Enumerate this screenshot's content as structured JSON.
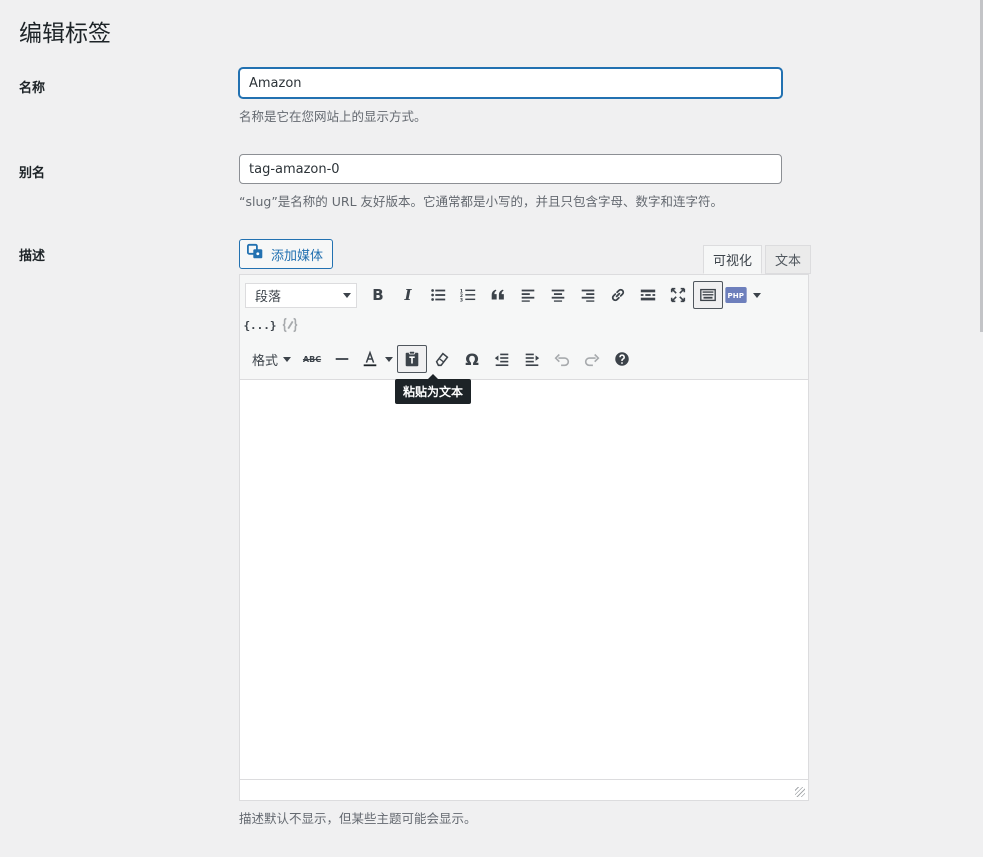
{
  "page": {
    "title": "编辑标签"
  },
  "fields": {
    "name": {
      "label": "名称",
      "value": "Amazon",
      "help": "名称是它在您网站上的显示方式。"
    },
    "slug": {
      "label": "别名",
      "value": "tag-amazon-0",
      "help": "“slug”是名称的 URL 友好版本。它通常都是小写的，并且只包含字母、数字和连字符。"
    },
    "description": {
      "label": "描述",
      "help": "描述默认不显示，但某些主题可能会显示。"
    }
  },
  "editor": {
    "media_button": "添加媒体",
    "tabs": {
      "visual": "可视化",
      "text": "文本"
    },
    "format_select": "段落",
    "format_menu": "格式",
    "tooltip": "粘贴为文本",
    "icons": {
      "bold": "B",
      "italic": "I",
      "strikethrough": "ABC",
      "omega": "Ω",
      "code": "{...}"
    }
  }
}
